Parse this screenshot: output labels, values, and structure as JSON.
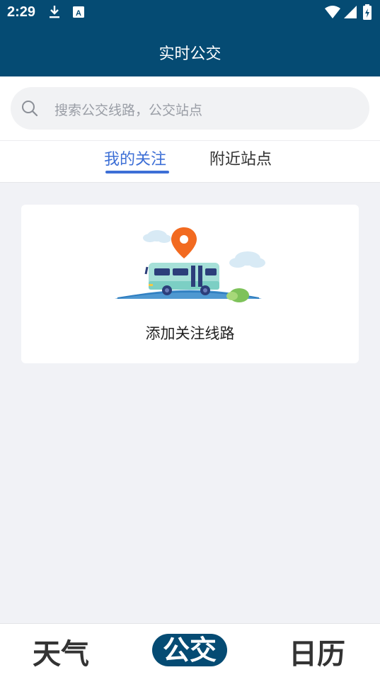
{
  "status_bar": {
    "time": "2:29",
    "icons": [
      "download-icon",
      "keyboard-a-icon",
      "wifi-icon",
      "signal-icon",
      "battery-icon"
    ]
  },
  "app_bar": {
    "title": "实时公交"
  },
  "search": {
    "placeholder": "搜索公交线路，公交站点"
  },
  "tabs": [
    {
      "label": "我的关注",
      "active": true
    },
    {
      "label": "附近站点",
      "active": false
    }
  ],
  "empty_card": {
    "text": "添加关注线路"
  },
  "bottom_nav": {
    "items": [
      {
        "label": "天气",
        "active": false
      },
      {
        "label": "公交",
        "active": true
      },
      {
        "label": "日历",
        "active": false
      }
    ]
  },
  "colors": {
    "primary": "#054b73",
    "accent": "#3d6fd6",
    "background": "#f1f2f6"
  }
}
